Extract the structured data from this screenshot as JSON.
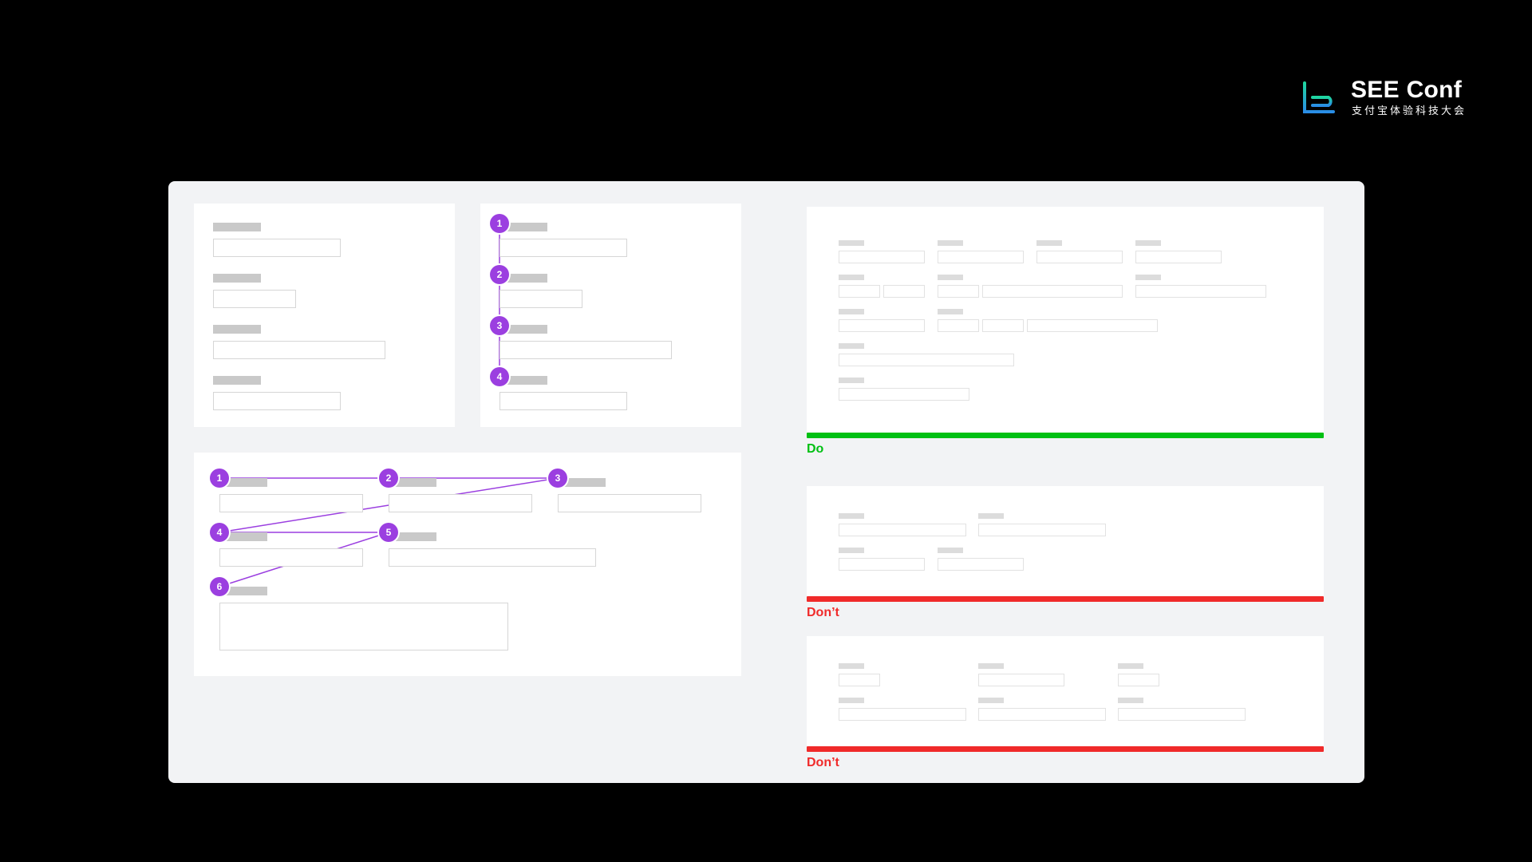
{
  "brand": {
    "title": "SEE Conf",
    "subtitle": "支付宝体验科技大会",
    "mark_colors": [
      "#1fc9a0",
      "#2a8de6"
    ]
  },
  "colors": {
    "badge": "#9b3fe0",
    "do": "#00c013",
    "dont": "#f02a2a"
  },
  "examples": {
    "vertical_order": {
      "steps": [
        "1",
        "2",
        "3",
        "4"
      ]
    },
    "grid_order": {
      "steps": [
        "1",
        "2",
        "3",
        "4",
        "5",
        "6"
      ]
    }
  },
  "guidelines": [
    {
      "verdict": "Do",
      "tone": "do"
    },
    {
      "verdict": "Don’t",
      "tone": "dont"
    },
    {
      "verdict": "Don’t",
      "tone": "dont"
    }
  ]
}
